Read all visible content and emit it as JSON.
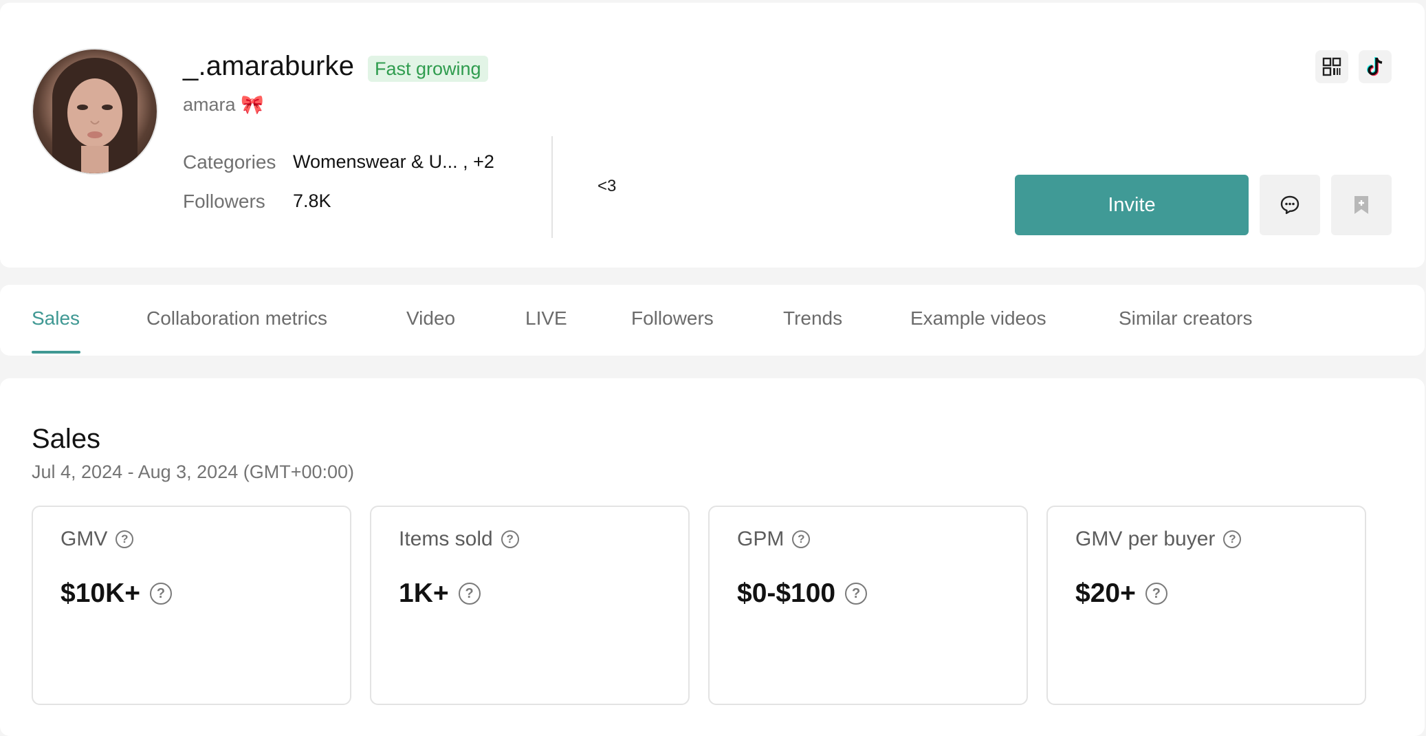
{
  "profile": {
    "username": "_.amaraburke",
    "badge": "Fast growing",
    "nickname": "amara 🎀",
    "categories_label": "Categories",
    "categories_value": "Womenswear & U... , +2",
    "followers_label": "Followers",
    "followers_value": "7.8K",
    "bio": "<3",
    "invite_label": "Invite"
  },
  "tabs": [
    {
      "label": "Sales",
      "active": true
    },
    {
      "label": "Collaboration metrics"
    },
    {
      "label": "Video"
    },
    {
      "label": "LIVE"
    },
    {
      "label": "Followers"
    },
    {
      "label": "Trends"
    },
    {
      "label": "Example videos"
    },
    {
      "label": "Similar creators"
    }
  ],
  "sales": {
    "title": "Sales",
    "date_range": "Jul 4, 2024 - Aug 3, 2024 (GMT+00:00)",
    "metrics": [
      {
        "label": "GMV",
        "value": "$10K+"
      },
      {
        "label": "Items sold",
        "value": "1K+"
      },
      {
        "label": "GPM",
        "value": "$0-$100"
      },
      {
        "label": "GMV per buyer",
        "value": "$20+"
      }
    ]
  },
  "colors": {
    "accent": "#409a96",
    "badge_bg": "#e2f4e6",
    "badge_text": "#2f9c4e"
  },
  "icons": {
    "qr": "qr-code-icon",
    "tiktok": "tiktok-icon",
    "message": "message-icon",
    "bookmark": "bookmark-add-icon",
    "help": "help-icon"
  }
}
